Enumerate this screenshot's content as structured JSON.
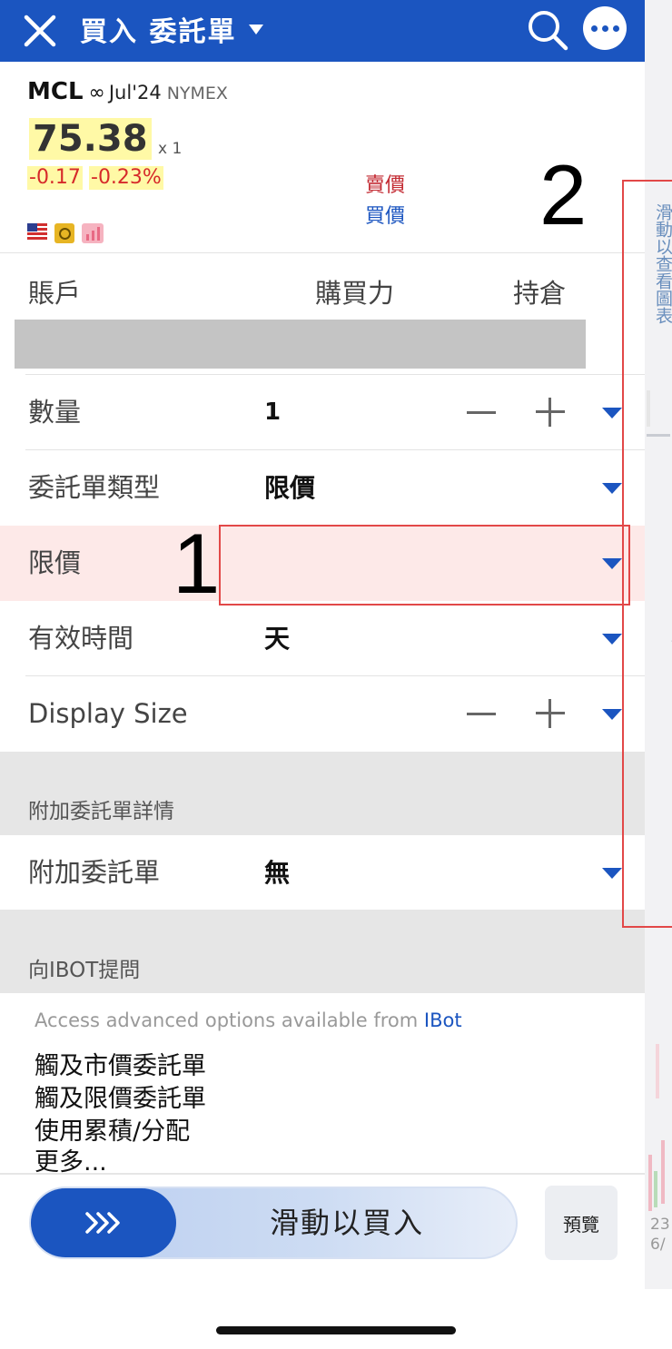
{
  "header": {
    "title": "買入 委託單",
    "close_icon": "close-icon",
    "search_icon": "search-icon",
    "more_icon": "more-icon"
  },
  "quote": {
    "symbol": "MCL",
    "infinity": "∞",
    "expiry": "Jul'24",
    "exchange": "NYMEX",
    "price": "75.38",
    "multiplier": "x 1",
    "change": "-0.17",
    "change_pct": "-0.23%",
    "sell_label": "賣價",
    "buy_label": "買價",
    "colors": {
      "up_down_red": "#d62a2a",
      "highlight": "#fff9a6"
    }
  },
  "account": {
    "col_account": "賬戶",
    "col_buying_power": "購買力",
    "col_position": "持倉"
  },
  "form": {
    "quantity_label": "數量",
    "quantity_value": "1",
    "order_type_label": "委託單類型",
    "order_type_value": "限價",
    "limit_price_label": "限價",
    "limit_price_value": "",
    "tif_label": "有效時間",
    "tif_value": "天",
    "display_size_label": "Display Size"
  },
  "attached": {
    "section_title": "附加委託單詳情",
    "label": "附加委託單",
    "value": "無"
  },
  "ibot": {
    "section_title": "向IBOT提問",
    "intro": "Access advanced options available from",
    "link": "IBot",
    "items": [
      "觸及市價委託單",
      "觸及限價委託單",
      "使用累積/分配",
      "更多..."
    ]
  },
  "bottom": {
    "slide_text": "滑動以買入",
    "preview": "預覽"
  },
  "side_panel": {
    "text": "滑動以查看圖表",
    "tick_top": "23",
    "tick_bottom": "6/"
  },
  "annotations": {
    "label_1": "1",
    "label_2": "2",
    "box_color": "#e24848"
  },
  "accent": "#1b55c0"
}
